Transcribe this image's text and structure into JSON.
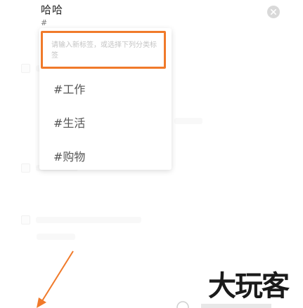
{
  "header": {
    "title": "哈哈",
    "hash_prefix": "#",
    "close_icon": "close-icon"
  },
  "tag_popup": {
    "input_placeholder": "请输入新标签，或选择下列分类标签",
    "input_value": "",
    "highlight_color": "#f07a2a",
    "tags": [
      {
        "label": "#工作"
      },
      {
        "label": "#生活"
      },
      {
        "label": "#购物"
      }
    ]
  },
  "overlay": {
    "arrow_color": "#f07a2a",
    "watermark_text": "大玩客"
  }
}
